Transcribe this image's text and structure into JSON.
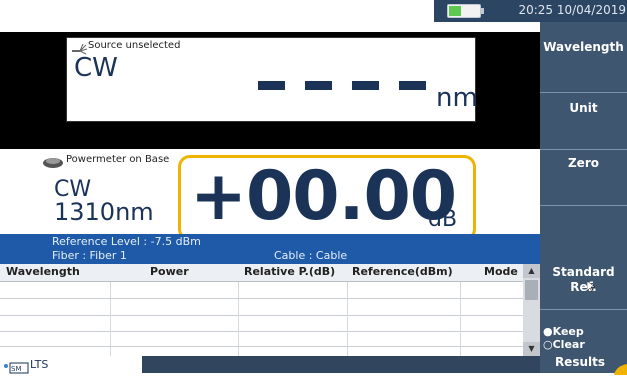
{
  "status_bar": {
    "datetime": "20:25 10/04/2019",
    "wifi_icon": "wifi-icon",
    "remote_icon": "remote-control-icon",
    "battery_icon": "battery-icon"
  },
  "source_panel": {
    "status": "Source unselected",
    "mode": "CW",
    "wavelength_value": "- - - -",
    "unit": "nm"
  },
  "powermeter_panel": {
    "status": "Powermeter on Base",
    "mode": "CW",
    "wavelength": "1310nm",
    "value": "+00.00",
    "unit": "dB"
  },
  "info_bar": {
    "reference_level": "Reference Level :  -7.5 dBm",
    "fiber": "Fiber : Fiber  1",
    "cable": "Cable : Cable"
  },
  "results_table": {
    "columns": [
      "Wavelength",
      "Power",
      "Relative P.(dB)",
      "Reference(dBm)",
      "Mode"
    ],
    "rows": []
  },
  "bottom_bar": {
    "app_label": "LTS"
  },
  "menu": {
    "wavelength": "Wavelength",
    "unit": "Unit",
    "zero": "Zero",
    "standard_ref_line1": "Standard",
    "standard_ref_line2": "Ref.",
    "keep": "Keep",
    "clear": "Clear",
    "results": "Results"
  },
  "colors": {
    "accent_frame": "#f0b400",
    "info_bar": "#1e5aa8",
    "menu_bg": "#3e5670",
    "text_primary": "#1a3357"
  }
}
